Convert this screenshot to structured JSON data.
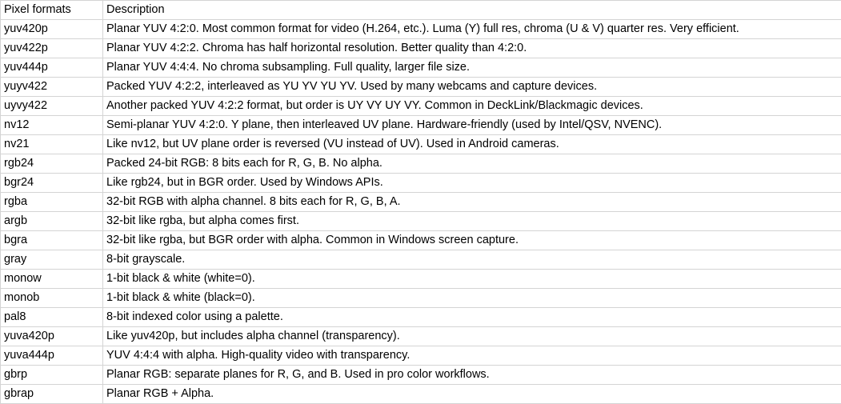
{
  "header": {
    "col1": "Pixel formats",
    "col2": "Description"
  },
  "rows": [
    {
      "format": "yuv420p",
      "description": "Planar YUV 4:2:0. Most common format for video (H.264, etc.). Luma (Y) full res, chroma (U & V) quarter res. Very efficient."
    },
    {
      "format": "yuv422p",
      "description": "Planar YUV 4:2:2. Chroma has half horizontal resolution. Better quality than 4:2:0."
    },
    {
      "format": "yuv444p",
      "description": "Planar YUV 4:4:4. No chroma subsampling. Full quality, larger file size."
    },
    {
      "format": "yuyv422",
      "description": "Packed YUV 4:2:2, interleaved as YU YV YU YV. Used by many webcams and capture devices."
    },
    {
      "format": "uyvy422",
      "description": "Another packed YUV 4:2:2 format, but order is UY VY UY VY. Common in DeckLink/Blackmagic devices."
    },
    {
      "format": "nv12",
      "description": "Semi-planar YUV 4:2:0. Y plane, then interleaved UV plane. Hardware-friendly (used by Intel/QSV, NVENC)."
    },
    {
      "format": "nv21",
      "description": "Like nv12, but UV plane order is reversed (VU instead of UV). Used in Android cameras."
    },
    {
      "format": "rgb24",
      "description": "Packed 24-bit RGB: 8 bits each for R, G, B. No alpha."
    },
    {
      "format": "bgr24",
      "description": "Like rgb24, but in BGR order. Used by Windows APIs."
    },
    {
      "format": "rgba",
      "description": "32-bit RGB with alpha channel. 8 bits each for R, G, B, A."
    },
    {
      "format": "argb",
      "description": "32-bit like rgba, but alpha comes first."
    },
    {
      "format": "bgra",
      "description": "32-bit like rgba, but BGR order with alpha. Common in Windows screen capture."
    },
    {
      "format": "gray",
      "description": "8-bit grayscale."
    },
    {
      "format": "monow",
      "description": "1-bit black & white (white=0)."
    },
    {
      "format": "monob",
      "description": "1-bit black & white (black=0)."
    },
    {
      "format": "pal8",
      "description": "8-bit indexed color using a palette."
    },
    {
      "format": "yuva420p",
      "description": "Like yuv420p, but includes alpha channel (transparency)."
    },
    {
      "format": "yuva444p",
      "description": "YUV 4:4:4 with alpha. High-quality video with transparency."
    },
    {
      "format": "gbrp",
      "description": "Planar RGB: separate planes for R, G, and B. Used in pro color workflows."
    },
    {
      "format": "gbrap",
      "description": "Planar RGB + Alpha."
    }
  ]
}
